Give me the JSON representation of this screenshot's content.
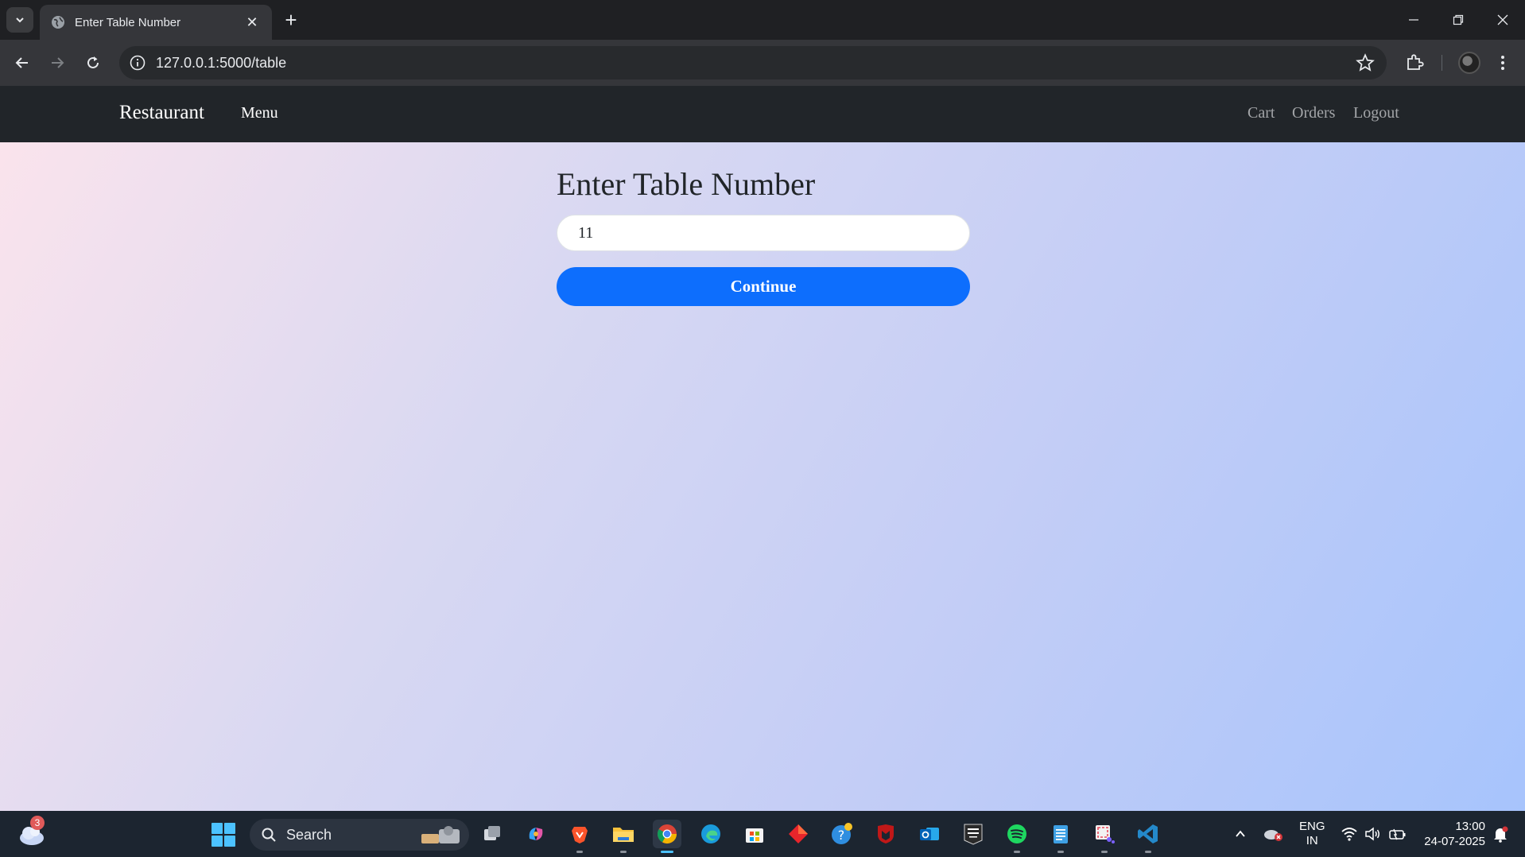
{
  "browser": {
    "tab_title": "Enter Table Number",
    "tab_close": "✕",
    "new_tab": "+",
    "url": "127.0.0.1:5000/table"
  },
  "site": {
    "brand": "Restaurant",
    "nav_left": [
      "Menu"
    ],
    "nav_right": [
      "Cart",
      "Orders",
      "Logout"
    ]
  },
  "form": {
    "heading": "Enter Table Number",
    "input_value": "11",
    "submit_label": "Continue"
  },
  "taskbar": {
    "weather_badge": "3",
    "search_label": "Search",
    "apps": [
      "task-view",
      "copilot",
      "brave",
      "file-explorer",
      "chrome",
      "edge",
      "microsoft-store",
      "app-red-diamond",
      "help",
      "mcafee",
      "outlook",
      "epic-games",
      "spotify",
      "notepad",
      "snipping-tool",
      "vs-code"
    ],
    "language": "ENG",
    "region": "IN",
    "time": "13:00",
    "date": "24-07-2025"
  },
  "colors": {
    "navbar": "#212529",
    "primary_button": "#0d6efd",
    "gradient_start": "#fce4ec",
    "gradient_end": "#a7c4fc",
    "chrome_dark": "#202124"
  }
}
